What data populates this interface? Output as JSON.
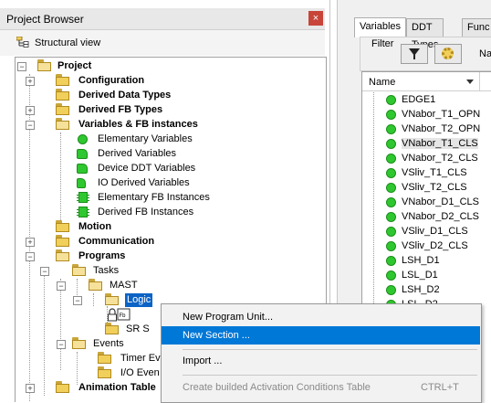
{
  "project_browser": {
    "title": "Project Browser",
    "close_label": "×",
    "view_label": "Structural view",
    "tree": [
      {
        "label": "Project",
        "bold": true
      },
      {
        "label": "Configuration",
        "bold": true
      },
      {
        "label": "Derived Data Types",
        "bold": true
      },
      {
        "label": "Derived FB Types",
        "bold": true
      },
      {
        "label": "Variables & FB instances",
        "bold": true
      },
      {
        "label": "Elementary Variables"
      },
      {
        "label": "Derived Variables"
      },
      {
        "label": "Device DDT Variables"
      },
      {
        "label": "IO Derived Variables"
      },
      {
        "label": "Elementary FB Instances"
      },
      {
        "label": "Derived FB Instances"
      },
      {
        "label": "Motion",
        "bold": true
      },
      {
        "label": "Communication",
        "bold": true
      },
      {
        "label": "Programs",
        "bold": true
      },
      {
        "label": "Tasks"
      },
      {
        "label": "MAST"
      },
      {
        "label": "Logic",
        "selected": true
      },
      {
        "label": "SR S"
      },
      {
        "label": "Events"
      },
      {
        "label": "Timer Eve"
      },
      {
        "label": "I/O Even"
      },
      {
        "label": "Animation Table",
        "bold": true
      }
    ]
  },
  "variables_panel": {
    "tabs": [
      {
        "label": "Variables",
        "active": true
      },
      {
        "label": "DDT Types"
      },
      {
        "label": "Func"
      }
    ],
    "filter_label": "Filter",
    "name_abbrev": "Na",
    "column_header": "Name",
    "rows": [
      "EDGE1",
      "VNabor_T1_OPN",
      "VNabor_T2_OPN",
      "VNabor_T1_CLS",
      "VNabor_T2_CLS",
      "VSliv_T1_CLS",
      "VSliv_T2_CLS",
      "VNabor_D1_CLS",
      "VNabor_D2_CLS",
      "VSliv_D1_CLS",
      "VSliv_D2_CLS",
      "LSH_D1",
      "LSL_D1",
      "LSH_D2",
      "LSL_D2"
    ]
  },
  "context_menu": {
    "items": [
      {
        "label": "New Program Unit...",
        "shortcut": "",
        "state": "normal"
      },
      {
        "label": "New Section ...",
        "shortcut": "",
        "state": "hover"
      },
      {
        "label": "Import ...",
        "shortcut": "",
        "state": "normal"
      },
      {
        "label": "Create builded Activation Conditions Table",
        "shortcut": "CTRL+T",
        "state": "disabled"
      }
    ]
  },
  "colors": {
    "selection": "#0b63c5",
    "menu_hover": "#0078d7",
    "status_green": "#2fc72f",
    "folder_yellow": "#f1cf5b",
    "close_red": "#c8453a"
  },
  "icons": {
    "folder": "folder-icon",
    "variable": "green-dot-icon",
    "fb_instance": "function-block-icon",
    "filter": "funnel-icon",
    "settings": "gear-icon",
    "section_lock": "lock-icon"
  }
}
